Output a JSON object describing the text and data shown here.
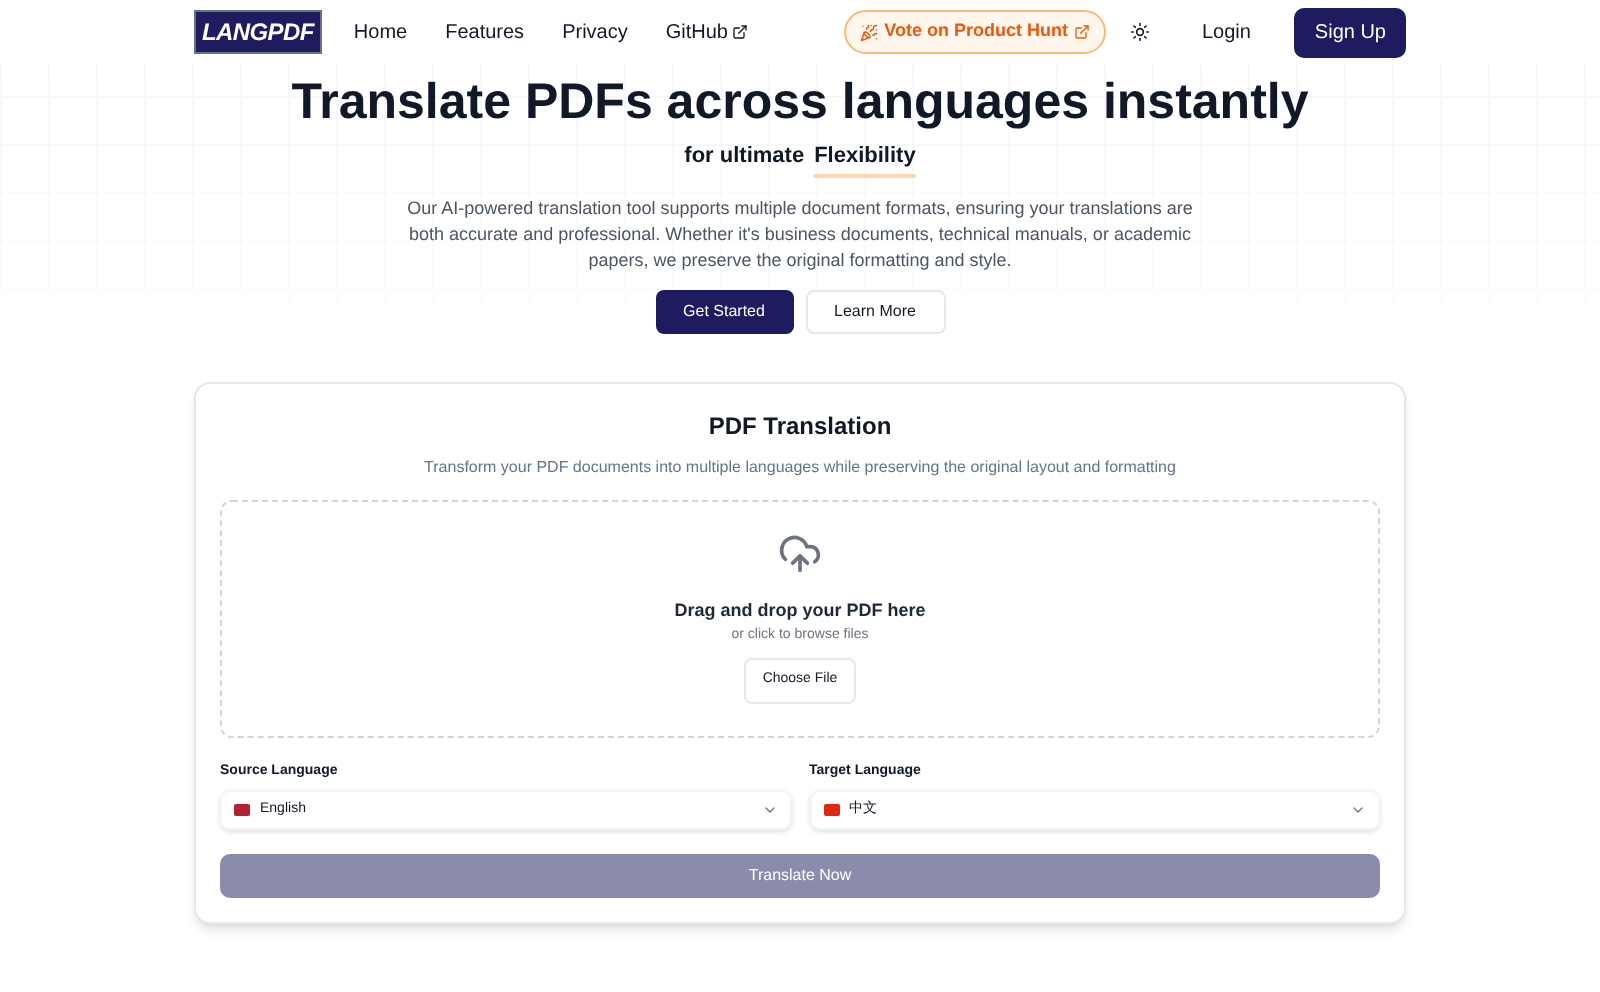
{
  "nav": {
    "logo": "LANGPDF",
    "links": [
      "Home",
      "Features",
      "Privacy",
      "GitHub"
    ],
    "vote": "Vote on Product Hunt",
    "login": "Login",
    "signup": "Sign Up"
  },
  "hero": {
    "title": "Translate PDFs across languages instantly",
    "subtitle_prefix": "for ultimate",
    "subtitle_highlight": "Flexibility",
    "description": "Our AI-powered translation tool supports multiple document formats, ensuring your translations are both accurate and professional. Whether it's business documents, technical manuals, or academic papers, we preserve the original formatting and style.",
    "primary_button": "Get Started",
    "secondary_button": "Learn More"
  },
  "card": {
    "title": "PDF Translation",
    "subtitle": "Transform your PDF documents into multiple languages while preserving the original layout and formatting",
    "dropzone": {
      "title": "Drag and drop your PDF here",
      "hint": "or click to browse files",
      "button": "Choose File"
    },
    "selects": [
      {
        "label": "Source Language",
        "value": "English",
        "color": "#b22234"
      },
      {
        "label": "Target Language",
        "value": "中文",
        "color": "#de2910"
      }
    ],
    "submit": {
      "label": "Translate Now",
      "disabled": true
    }
  }
}
